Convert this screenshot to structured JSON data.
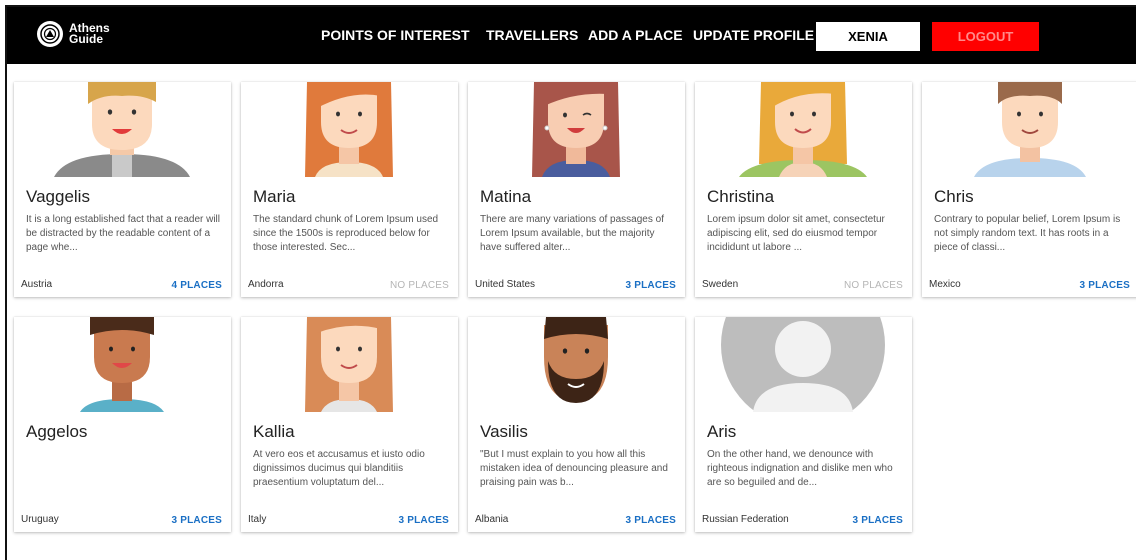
{
  "brand": {
    "line1": "Athens",
    "line2": "Guide"
  },
  "nav": {
    "points_of_interest": "POINTS OF INTEREST",
    "travellers": "TRAVELLERS",
    "add_place": "ADD A PLACE",
    "update_profile": "UPDATE PROFILE",
    "user": "XENIA",
    "logout": "LOGOUT"
  },
  "colors": {
    "accent": "#1a6fc4",
    "logout": "#ff0000",
    "navbar": "#000000"
  },
  "travellers": [
    {
      "name": "Vaggelis",
      "description": "It is a long established fact that a reader will be distracted by the readable content of a page whe...",
      "country": "Austria",
      "places": "4 PLACES",
      "avatar_icon": "man-blond-avatar-icon"
    },
    {
      "name": "Maria",
      "description": "The standard chunk of Lorem Ipsum used since the 1500s is reproduced below for those interested. Sec...",
      "country": "Andorra",
      "places": "NO PLACES",
      "avatar_icon": "woman-red-hair-avatar-icon"
    },
    {
      "name": "Matina",
      "description": "There are many variations of passages of Lorem Ipsum available, but the majority have suffered alter...",
      "country": "United States",
      "places": "3 PLACES",
      "avatar_icon": "woman-brown-hair-winking-avatar-icon"
    },
    {
      "name": "Christina",
      "description": "Lorem ipsum dolor sit amet, consectetur adipiscing elit, sed do eiusmod tempor incididunt ut labore ...",
      "country": "Sweden",
      "places": "NO PLACES",
      "avatar_icon": "woman-blonde-avatar-icon"
    },
    {
      "name": "Chris",
      "description": "Contrary to popular belief, Lorem Ipsum is not simply random text. It has roots in a piece of classi...",
      "country": "Mexico",
      "places": "3 PLACES",
      "avatar_icon": "man-brown-hair-avatar-icon"
    },
    {
      "name": "Aggelos",
      "description": "",
      "country": "Uruguay",
      "places": "3 PLACES",
      "avatar_icon": "man-dark-skin-avatar-icon"
    },
    {
      "name": "Kallia",
      "description": "At vero eos et accusamus et iusto odio dignissimos ducimus qui blanditiis praesentium voluptatum del...",
      "country": "Italy",
      "places": "3 PLACES",
      "avatar_icon": "woman-auburn-hair-avatar-icon"
    },
    {
      "name": "Vasilis",
      "description": "\"But I must explain to you how all this mistaken idea of denouncing pleasure and praising pain was b...",
      "country": "Albania",
      "places": "3 PLACES",
      "avatar_icon": "man-beard-avatar-icon"
    },
    {
      "name": "Aris",
      "description": "On the other hand, we denounce with righteous indignation and dislike men who are so beguiled and de...",
      "country": "Russian Federation",
      "places": "3 PLACES",
      "avatar_icon": "default-user-avatar-icon"
    }
  ]
}
